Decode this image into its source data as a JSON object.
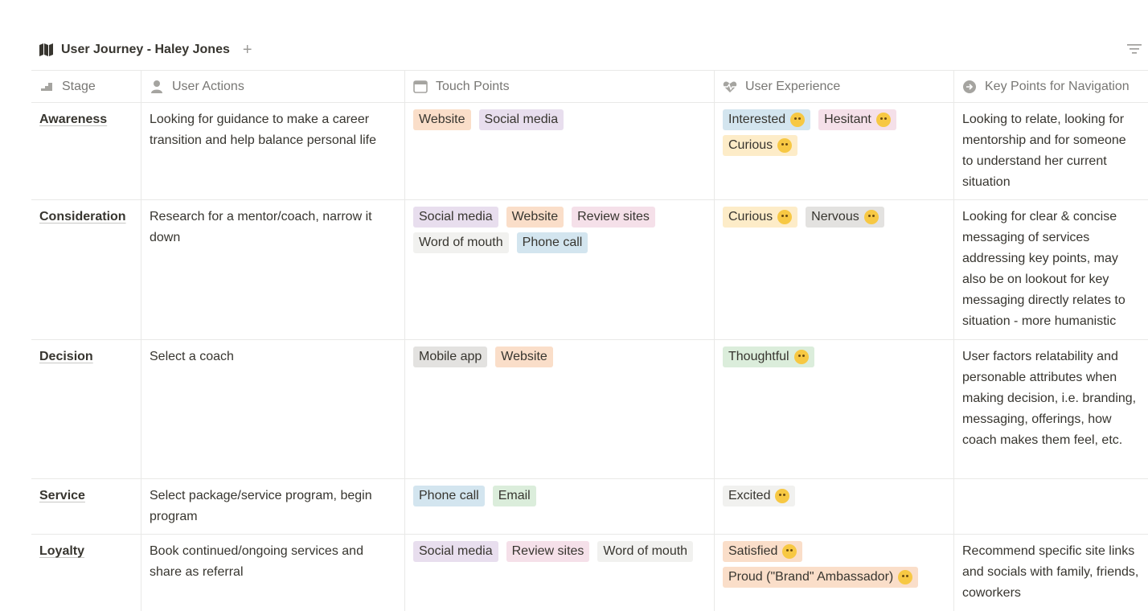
{
  "header": {
    "title": "User Journey - Haley Jones",
    "add_view": "+"
  },
  "columns": [
    {
      "label": "Stage",
      "icon": "stairs-icon"
    },
    {
      "label": "User Actions",
      "icon": "person-icon"
    },
    {
      "label": "Touch Points",
      "icon": "browser-icon"
    },
    {
      "label": "User Experience",
      "icon": "heartbeat-icon"
    },
    {
      "label": "Key Points for Navigation",
      "icon": "arrow-circle-icon"
    }
  ],
  "tag_colors": {
    "Website": "#fadec9",
    "Social media": "#e8deee",
    "Review sites": "#f5e0e9",
    "Word of mouth": "#f1f1ef",
    "Phone call": "#d3e5ef",
    "Mobile app": "#e3e2e0",
    "Email": "#dbeddb",
    "Interested": "#d3e5ef",
    "Hesitant": "#f5e0e9",
    "Curious": "#fdecc8",
    "Nervous": "#e3e2e0",
    "Thoughtful": "#dbeddb",
    "Excited": "#f1f1ef",
    "Satisfied": "#fadec9",
    "Proud": "#fadec9"
  },
  "rows": [
    {
      "stage": "Awareness",
      "actions": "Looking for guidance to make a career transition and help balance personal life",
      "touch_points": [
        "Website",
        "Social media"
      ],
      "experience": [
        {
          "label": "Interested",
          "emoji": "thinking-face-icon",
          "color": "Interested"
        },
        {
          "label": "Hesitant",
          "emoji": "neutral-face-icon",
          "color": "Hesitant"
        },
        {
          "label": "Curious",
          "emoji": "rolling-eyes-face-icon",
          "color": "Curious"
        }
      ],
      "navigation": "Looking to relate, looking for mentorship and for someone to understand her current situation"
    },
    {
      "stage": "Consideration",
      "actions": "Research for a mentor/coach, narrow it down",
      "touch_points": [
        "Social media",
        "Website",
        "Review sites",
        "Word of mouth",
        "Phone call"
      ],
      "experience": [
        {
          "label": "Curious",
          "emoji": "rolling-eyes-face-icon",
          "color": "Curious"
        },
        {
          "label": "Nervous",
          "emoji": "anxious-face-icon",
          "color": "Nervous"
        }
      ],
      "navigation": "Looking for clear & concise messaging of services addressing key points, may also be on lookout for key messaging directly relates to situation - more humanistic"
    },
    {
      "stage": "Decision",
      "actions": "Select a coach",
      "touch_points": [
        "Mobile app",
        "Website"
      ],
      "experience": [
        {
          "label": "Thoughtful",
          "emoji": "thinking-face-icon",
          "color": "Thoughtful"
        }
      ],
      "navigation": "User factors relatability and personable attributes when making decision, i.e. branding, messaging, offerings, how coach makes them feel, etc."
    },
    {
      "stage": "Service",
      "actions": "Select package/service program, begin program",
      "touch_points": [
        "Phone call",
        "Email"
      ],
      "experience": [
        {
          "label": "Excited",
          "emoji": "grinning-face-icon",
          "color": "Excited"
        }
      ],
      "navigation": ""
    },
    {
      "stage": "Loyalty",
      "actions": "Book continued/ongoing services and share as referral",
      "touch_points": [
        "Social media",
        "Review sites",
        "Word of mouth"
      ],
      "experience": [
        {
          "label": "Satisfied",
          "emoji": "slightly-smiling-face-icon",
          "color": "Satisfied"
        },
        {
          "label": "Proud (\"Brand\" Ambassador)",
          "emoji": "saluting-face-icon",
          "color": "Proud"
        }
      ],
      "navigation": "Recommend specific site links and socials with family, friends, coworkers"
    }
  ]
}
